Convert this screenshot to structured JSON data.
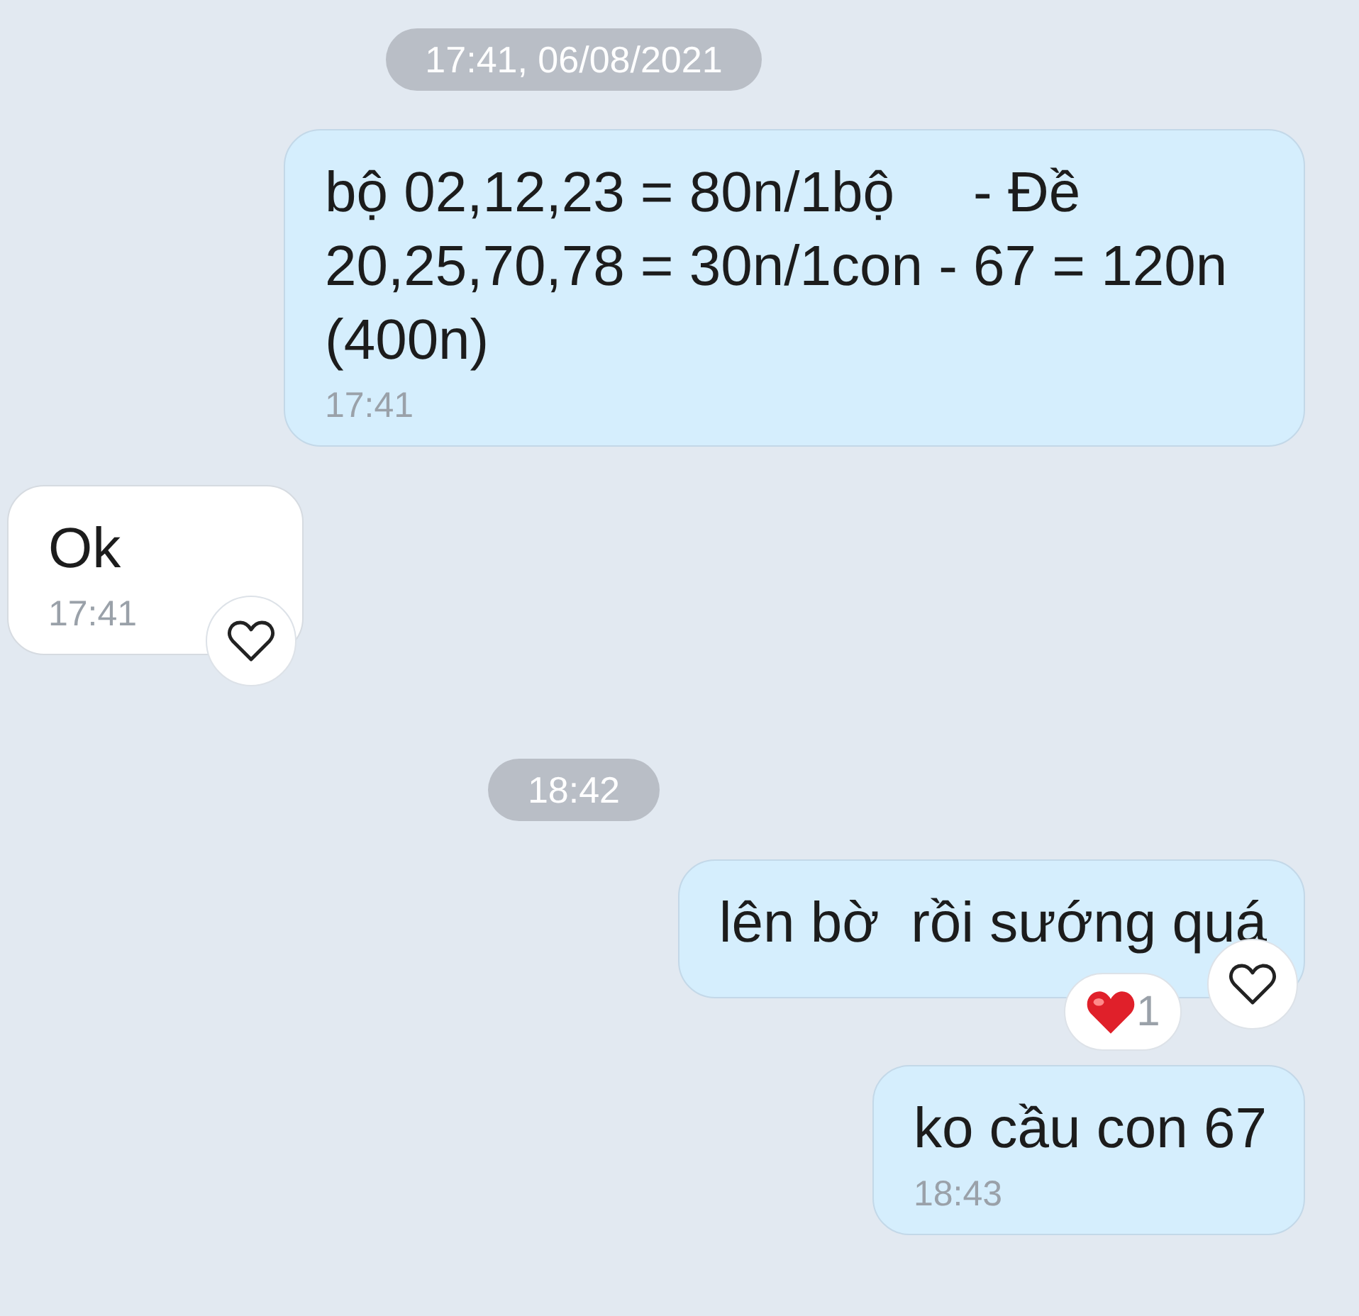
{
  "messages": [
    {
      "kind": "time",
      "text": "17:41, 06/08/2021"
    },
    {
      "kind": "message",
      "incoming": false,
      "text": "bộ 02,12,23 = 80n/1bộ     - Đề 20,25,70,78 = 30n/1con - 67 = 120n (400n)",
      "time": "17:41"
    },
    {
      "kind": "message",
      "incoming": true,
      "text": "Ok",
      "time": "17:41",
      "like_button": true
    },
    {
      "kind": "time",
      "text": "18:42"
    },
    {
      "kind": "message",
      "incoming": false,
      "text": "lên bờ  rồi sướng quá",
      "like_button": true,
      "reaction_count": "1"
    },
    {
      "kind": "message",
      "incoming": false,
      "text": "ko cầu con 67",
      "time": "18:43"
    }
  ]
}
